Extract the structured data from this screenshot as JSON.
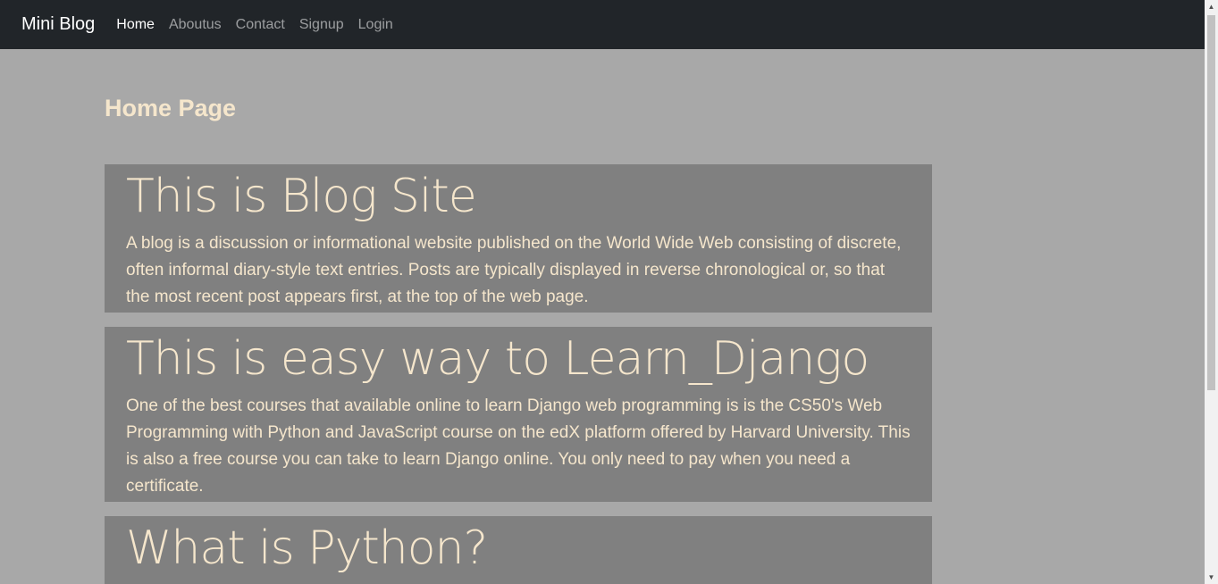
{
  "navbar": {
    "brand": "Mini Blog",
    "links": [
      {
        "label": "Home",
        "active": true
      },
      {
        "label": "Aboutus",
        "active": false
      },
      {
        "label": "Contact",
        "active": false
      },
      {
        "label": "Signup",
        "active": false
      },
      {
        "label": "Login",
        "active": false
      }
    ]
  },
  "page": {
    "title": "Home Page"
  },
  "posts": [
    {
      "title": "This is Blog Site",
      "body": "A blog is a discussion or informational website published on the World Wide Web consisting of discrete, often informal diary-style text entries. Posts are typically displayed in reverse chronological or, so that the most recent post appears first, at the top of the web page."
    },
    {
      "title": "This is easy way to Learn_Django",
      "body": "One of the best courses that available online to learn Django web programming is is the CS50's Web Programming with Python and JavaScript course on the edX platform offered by Harvard University. This is also a free course you can take to learn Django online. You only need to pay when you need a certificate."
    },
    {
      "title": "What is Python?",
      "body": ""
    }
  ],
  "colors": {
    "navbar_bg": "#212529",
    "page_bg": "#a8a8a8",
    "card_bg": "#808080",
    "text_cream": "#f5e6cc"
  },
  "icons": {
    "scroll_up": "triangle-up-icon",
    "scroll_down": "triangle-down-icon"
  }
}
